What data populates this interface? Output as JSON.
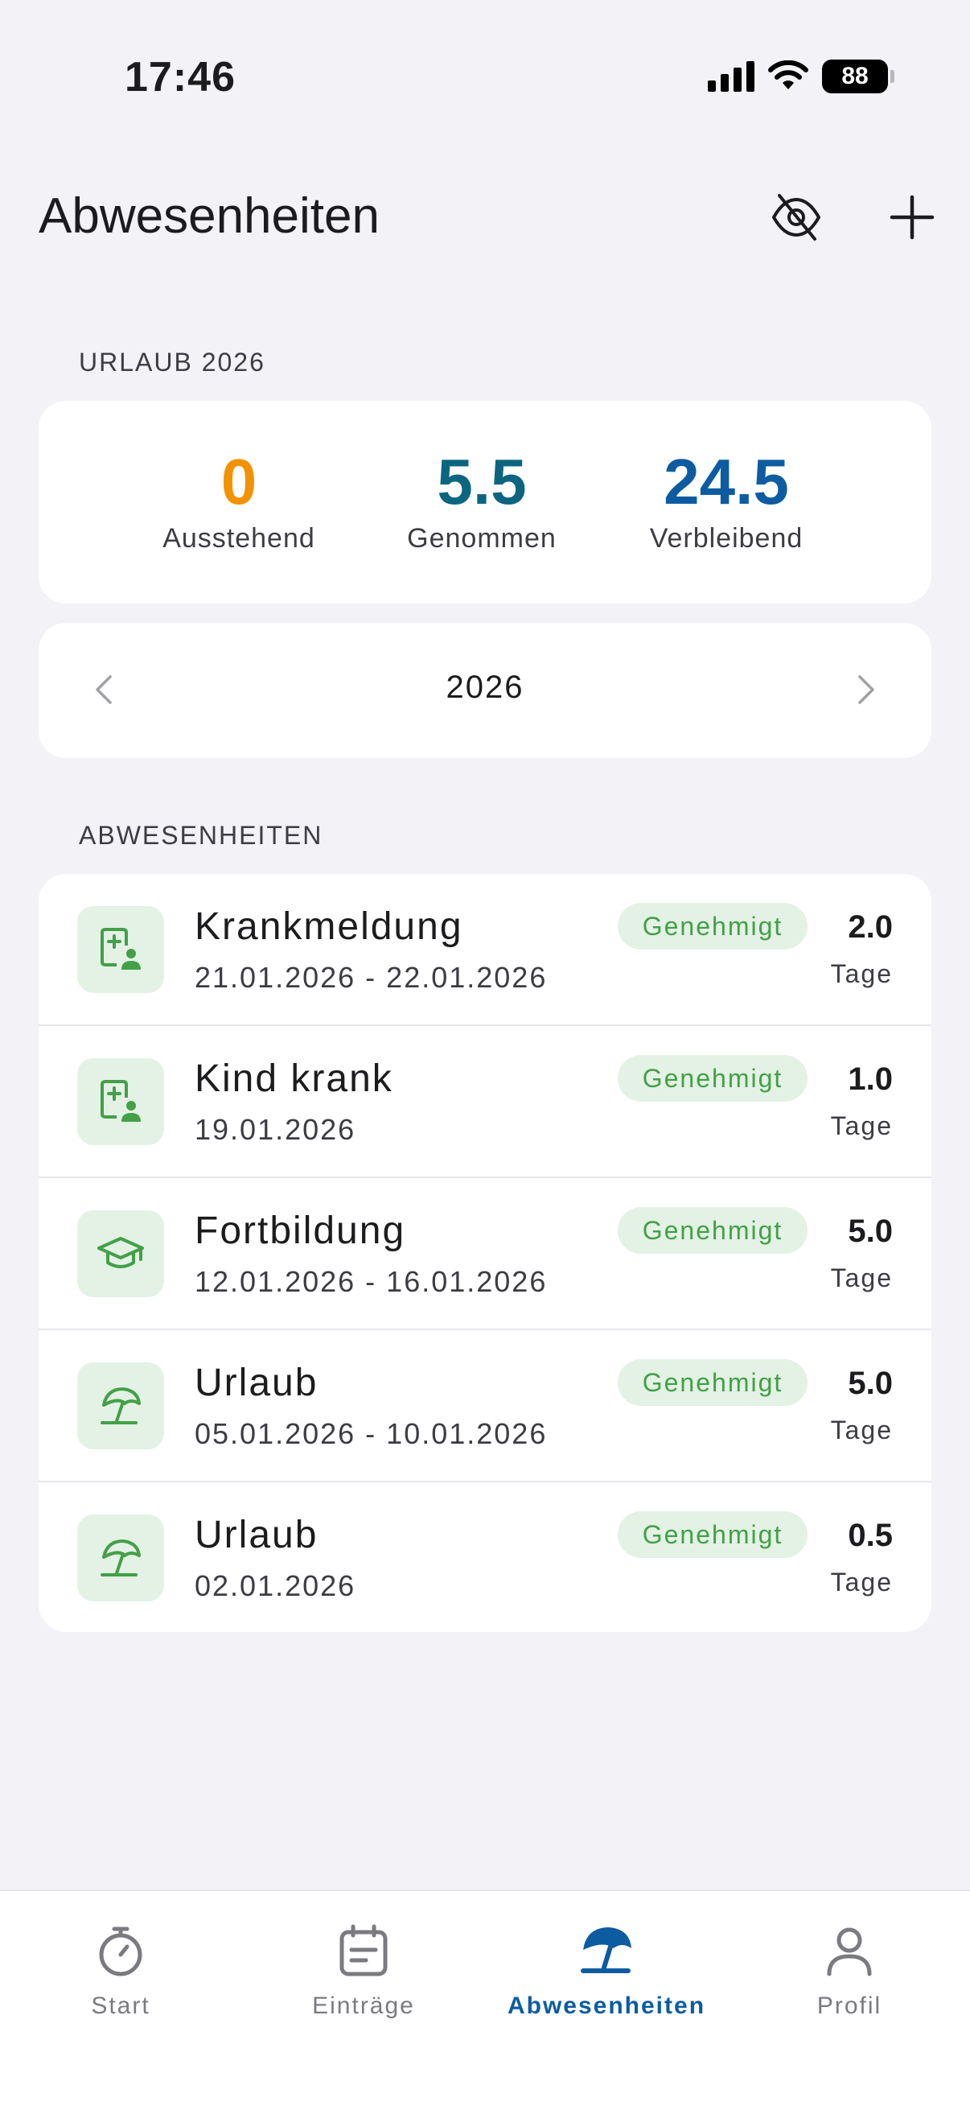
{
  "status_bar": {
    "time": "17:46",
    "battery": "88"
  },
  "header": {
    "title": "Abwesenheiten"
  },
  "vacation": {
    "section_label": "URLAUB 2026",
    "stats": [
      {
        "value": "0",
        "label": "Ausstehend",
        "color": "#f39200"
      },
      {
        "value": "5.5",
        "label": "Genommen",
        "color": "#0b6580"
      },
      {
        "value": "24.5",
        "label": "Verbleibend",
        "color": "#0d5ca1"
      }
    ]
  },
  "year_selector": {
    "year": "2026"
  },
  "absences": {
    "section_label": "ABWESENHEITEN",
    "items": [
      {
        "title": "Krankmeldung",
        "date": "21.01.2026 - 22.01.2026",
        "status": "Genehmigt",
        "days": "2.0",
        "unit": "Tage",
        "icon": "medical-person-icon"
      },
      {
        "title": "Kind krank",
        "date": "19.01.2026",
        "status": "Genehmigt",
        "days": "1.0",
        "unit": "Tage",
        "icon": "medical-person-icon"
      },
      {
        "title": "Fortbildung",
        "date": "12.01.2026 - 16.01.2026",
        "status": "Genehmigt",
        "days": "5.0",
        "unit": "Tage",
        "icon": "graduation-cap-icon"
      },
      {
        "title": "Urlaub",
        "date": "05.01.2026 - 10.01.2026",
        "status": "Genehmigt",
        "days": "5.0",
        "unit": "Tage",
        "icon": "beach-umbrella-icon"
      },
      {
        "title": "Urlaub",
        "date": "02.01.2026",
        "status": "Genehmigt",
        "days": "0.5",
        "unit": "Tage",
        "icon": "beach-umbrella-icon"
      }
    ]
  },
  "tabbar": {
    "tabs": [
      {
        "label": "Start",
        "icon": "stopwatch-icon"
      },
      {
        "label": "Einträge",
        "icon": "calendar-list-icon"
      },
      {
        "label": "Abwesenheiten",
        "icon": "beach-umbrella-icon",
        "active": true
      },
      {
        "label": "Profil",
        "icon": "person-icon"
      }
    ]
  },
  "colors": {
    "accent": "#0d5ca1",
    "approved": "#43a047",
    "approved_bg": "#e3f2e5",
    "background": "#f2f2f7"
  }
}
